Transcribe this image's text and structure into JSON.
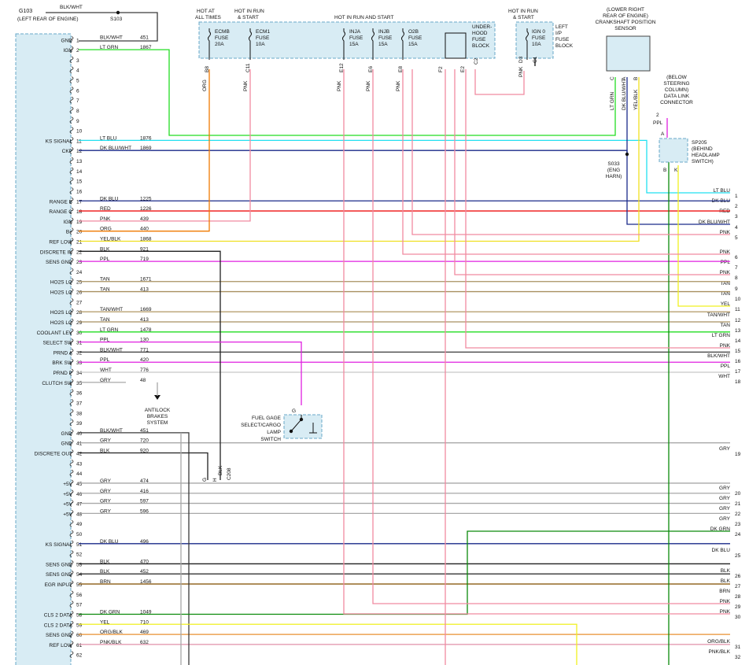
{
  "ground": {
    "g_label": "G103",
    "g_note": "(LEFT REAR OF ENGINE)",
    "wire": "BLK/WHT",
    "splice": "S103"
  },
  "fuse_block": {
    "hdr_hot": [
      "HOT AT",
      "ALL TIMES"
    ],
    "hdr_run1": [
      "HOT IN RUN",
      "& START"
    ],
    "hdr_run2": "HOT IN RUN AND START",
    "block_label": [
      "UNDER-",
      "HOOD",
      "FUSE",
      "BLOCK"
    ],
    "fuses": [
      {
        "name": "ECMB",
        "word": "FUSE",
        "amp": "20A",
        "pin": "B8",
        "color": "ORG"
      },
      {
        "name": "ECM1",
        "word": "FUSE",
        "amp": "10A",
        "pin": "C11",
        "color": "PNK"
      },
      {
        "name": "INJA",
        "word": "FUSE",
        "amp": "15A",
        "pin": "E12",
        "color": "PNK"
      },
      {
        "name": "INJB",
        "word": "FUSE",
        "amp": "15A",
        "pin": "E6",
        "color": "PNK"
      },
      {
        "name": "O2B",
        "word": "FUSE",
        "amp": "15A",
        "pin": "E8",
        "color": "PNK",
        "pin2": "E8"
      }
    ],
    "extra_pins": [
      "F2",
      "E2",
      "C2"
    ]
  },
  "ip_block": {
    "hdr": [
      "HOT IN RUN",
      "& START"
    ],
    "fuse_name": "IGN 0",
    "word": "FUSE",
    "amp": "10A",
    "label": [
      "LEFT",
      "I/P",
      "FUSE",
      "BLOCK"
    ],
    "pins": [
      "D3",
      "C1"
    ],
    "color": "PNK"
  },
  "ckp_sensor": {
    "title": [
      "(LOWER RIGHT",
      "REAR OF ENGINE)",
      "CRANKSHAFT POSITION",
      "SENSOR"
    ],
    "pins": [
      "C",
      "A",
      "B"
    ],
    "colors": [
      "LT GRN",
      "DK BLU/WHT",
      "YEL/BLK"
    ]
  },
  "dlc": {
    "title": [
      "(BELOW",
      "STEERING",
      "COLUMN)",
      "DATA LINK",
      "CONNECTOR"
    ],
    "pin": "2",
    "color": "PPL"
  },
  "sp205": {
    "label": [
      "SP205",
      "(BEHIND",
      "HEADLAMP",
      "SWITCH)"
    ],
    "pins": [
      "A",
      "B",
      "K"
    ]
  },
  "s033": {
    "label": [
      "S033",
      "(ENG",
      "HARN)"
    ]
  },
  "fuel_switch": {
    "label": [
      "FUEL GAGE",
      "SELECT/CARGO",
      "LAMP",
      "SWITCH"
    ],
    "pin": "G"
  },
  "abs": {
    "label": [
      "ANTILOCK",
      "BRAKES",
      "SYSTEM"
    ]
  },
  "c208": {
    "pins": [
      "G",
      "H"
    ],
    "color": "BLK",
    "conn": "C208"
  },
  "pins": [
    {
      "n": "1",
      "label": "GND",
      "color": "BLK/WHT",
      "circuit": "451"
    },
    {
      "n": "2",
      "label": "IGN",
      "color": "LT GRN",
      "circuit": "1867"
    },
    {
      "n": "3",
      "label": "",
      "color": "",
      "circuit": ""
    },
    {
      "n": "4",
      "label": "",
      "color": "",
      "circuit": ""
    },
    {
      "n": "5",
      "label": "",
      "color": "",
      "circuit": ""
    },
    {
      "n": "6",
      "label": "",
      "color": "",
      "circuit": ""
    },
    {
      "n": "7",
      "label": "",
      "color": "",
      "circuit": ""
    },
    {
      "n": "8",
      "label": "",
      "color": "",
      "circuit": ""
    },
    {
      "n": "9",
      "label": "",
      "color": "",
      "circuit": ""
    },
    {
      "n": "10",
      "label": "",
      "color": "",
      "circuit": ""
    },
    {
      "n": "11",
      "label": "KS SIGNAL",
      "color": "LT BLU",
      "circuit": "1876"
    },
    {
      "n": "12",
      "label": "CKP",
      "color": "DK BLU/WHT",
      "circuit": "1869"
    },
    {
      "n": "13",
      "label": "",
      "color": "",
      "circuit": ""
    },
    {
      "n": "14",
      "label": "",
      "color": "",
      "circuit": ""
    },
    {
      "n": "15",
      "label": "",
      "color": "",
      "circuit": ""
    },
    {
      "n": "16",
      "label": "",
      "color": "",
      "circuit": ""
    },
    {
      "n": "17",
      "label": "RANGE B",
      "color": "DK BLU",
      "circuit": "1225"
    },
    {
      "n": "18",
      "label": "RANGE C",
      "color": "RED",
      "circuit": "1226"
    },
    {
      "n": "19",
      "label": "IGN",
      "color": "PNK",
      "circuit": "439"
    },
    {
      "n": "20",
      "label": "B+",
      "color": "ORG",
      "circuit": "440"
    },
    {
      "n": "21",
      "label": "REF LOW",
      "color": "YEL/BLK",
      "circuit": "1868"
    },
    {
      "n": "22",
      "label": "DISCRETE IN",
      "color": "BLK",
      "circuit": "921"
    },
    {
      "n": "23",
      "label": "SENS GND",
      "color": "PPL",
      "circuit": "719"
    },
    {
      "n": "24",
      "label": "",
      "color": "",
      "circuit": ""
    },
    {
      "n": "25",
      "label": "HO2S LO",
      "color": "TAN",
      "circuit": "1671"
    },
    {
      "n": "26",
      "label": "HO2S LO",
      "color": "TAN",
      "circuit": "413"
    },
    {
      "n": "27",
      "label": "",
      "color": "",
      "circuit": ""
    },
    {
      "n": "28",
      "label": "HO2S LO",
      "color": "TAN/WHT",
      "circuit": "1669"
    },
    {
      "n": "29",
      "label": "HO2S LO",
      "color": "TAN",
      "circuit": "413"
    },
    {
      "n": "30",
      "label": "COOLANT LEV",
      "color": "LT GRN",
      "circuit": "1478"
    },
    {
      "n": "31",
      "label": "SELECT SW",
      "color": "PPL",
      "circuit": "130"
    },
    {
      "n": "32",
      "label": "PRND A",
      "color": "BLK/WHT",
      "circuit": "771"
    },
    {
      "n": "33",
      "label": "BRK SW",
      "color": "PPL",
      "circuit": "420"
    },
    {
      "n": "34",
      "label": "PRND P",
      "color": "WHT",
      "circuit": "776"
    },
    {
      "n": "35",
      "label": "CLUTCH SW",
      "color": "GRY",
      "circuit": "48"
    },
    {
      "n": "36",
      "label": "",
      "color": "",
      "circuit": ""
    },
    {
      "n": "37",
      "label": "",
      "color": "",
      "circuit": ""
    },
    {
      "n": "38",
      "label": "",
      "color": "",
      "circuit": ""
    },
    {
      "n": "39",
      "label": "",
      "color": "",
      "circuit": ""
    },
    {
      "n": "40",
      "label": "GND",
      "color": "BLK/WHT",
      "circuit": "451"
    },
    {
      "n": "41",
      "label": "GND",
      "color": "GRY",
      "circuit": "720"
    },
    {
      "n": "42",
      "label": "DISCRETE OUT",
      "color": "BLK",
      "circuit": "920"
    },
    {
      "n": "43",
      "label": "",
      "color": "",
      "circuit": ""
    },
    {
      "n": "44",
      "label": "",
      "color": "",
      "circuit": ""
    },
    {
      "n": "45",
      "label": "+5V",
      "color": "GRY",
      "circuit": "474"
    },
    {
      "n": "46",
      "label": "+5V",
      "color": "GRY",
      "circuit": "416"
    },
    {
      "n": "47",
      "label": "+5V",
      "color": "GRY",
      "circuit": "597"
    },
    {
      "n": "48",
      "label": "+5V",
      "color": "GRY",
      "circuit": "596"
    },
    {
      "n": "49",
      "label": "",
      "color": "",
      "circuit": ""
    },
    {
      "n": "50",
      "label": "",
      "color": "",
      "circuit": ""
    },
    {
      "n": "51",
      "label": "KS SIGNAL",
      "color": "DK BLU",
      "circuit": "496"
    },
    {
      "n": "52",
      "label": "",
      "color": "",
      "circuit": ""
    },
    {
      "n": "53",
      "label": "SENS GND",
      "color": "BLK",
      "circuit": "470"
    },
    {
      "n": "54",
      "label": "SENS GND",
      "color": "BLK",
      "circuit": "452"
    },
    {
      "n": "55",
      "label": "EGR INPUT",
      "color": "BRN",
      "circuit": "1456"
    },
    {
      "n": "56",
      "label": "",
      "color": "",
      "circuit": ""
    },
    {
      "n": "57",
      "label": "",
      "color": "",
      "circuit": ""
    },
    {
      "n": "58",
      "label": "CLS 2 DATA",
      "color": "DK GRN",
      "circuit": "1049"
    },
    {
      "n": "59",
      "label": "CLS 2 DATA",
      "color": "YEL",
      "circuit": "710"
    },
    {
      "n": "60",
      "label": "SENS GND",
      "color": "ORG/BLK",
      "circuit": "469"
    },
    {
      "n": "61",
      "label": "REF LOW",
      "color": "PNK/BLK",
      "circuit": "632"
    },
    {
      "n": "62",
      "label": "",
      "color": "",
      "circuit": ""
    }
  ],
  "outputs": [
    {
      "n": "1",
      "color": "LT BLU"
    },
    {
      "n": "2",
      "color": "DK BLU"
    },
    {
      "n": "3",
      "color": "RED"
    },
    {
      "n": "4",
      "color": "DK BLU/WHT"
    },
    {
      "n": "5",
      "color": "PNK"
    },
    {
      "n": "6",
      "color": "PNK"
    },
    {
      "n": "7",
      "color": "PPL"
    },
    {
      "n": "8",
      "color": "PNK"
    },
    {
      "n": "9",
      "color": "TAN"
    },
    {
      "n": "10",
      "color": "TAN"
    },
    {
      "n": "11",
      "color": "YEL"
    },
    {
      "n": "12",
      "color": "TAN/WHT"
    },
    {
      "n": "13",
      "color": "TAN"
    },
    {
      "n": "14",
      "color": "LT GRN"
    },
    {
      "n": "15",
      "color": "PNK"
    },
    {
      "n": "16",
      "color": "BLK/WHT"
    },
    {
      "n": "17",
      "color": "PPL"
    },
    {
      "n": "18",
      "color": "WHT"
    },
    {
      "n": "19",
      "color": "GRY"
    },
    {
      "n": "20",
      "color": "GRY"
    },
    {
      "n": "21",
      "color": "GRY"
    },
    {
      "n": "22",
      "color": "GRY"
    },
    {
      "n": "23",
      "color": "GRY"
    },
    {
      "n": "24",
      "color": "DK GRN"
    },
    {
      "n": "25",
      "color": "DK BLU"
    },
    {
      "n": "26",
      "color": "BLK"
    },
    {
      "n": "27",
      "color": "BLK"
    },
    {
      "n": "28",
      "color": "BRN"
    },
    {
      "n": "29",
      "color": "PNK"
    },
    {
      "n": "30",
      "color": "PNK"
    },
    {
      "n": "31",
      "color": "ORG/BLK"
    },
    {
      "n": "32",
      "color": "PNK/BLK"
    }
  ],
  "wire_colors": {
    "BLK": "#202020",
    "BLK/WHT": "#3a3a3a",
    "LT GRN": "#22dd22",
    "LT BLU": "#22e0f0",
    "DK BLU": "#1a2a8a",
    "DK BLU/WHT": "#1a2a8a",
    "RED": "#ee1111",
    "PNK": "#f08aa0",
    "ORG": "#f07a00",
    "YEL/BLK": "#f0e020",
    "PPL": "#e020e0",
    "TAN": "#a89060",
    "TAN/WHT": "#b8a070",
    "WHT": "#c8c8c8",
    "GRY": "#a8a8a8",
    "BRN": "#8a5a10",
    "DK GRN": "#0a8a0a",
    "YEL": "#f0f020",
    "ORG/BLK": "#e89030",
    "PNK/BLK": "#e090a8"
  }
}
